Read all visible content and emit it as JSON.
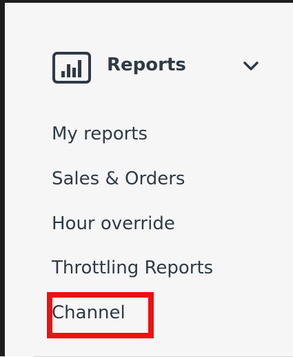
{
  "sidebar": {
    "section": {
      "label": "Reports",
      "icon": "bar-chart-icon",
      "toggle_icon": "chevron-down-icon",
      "expanded": true
    },
    "items": [
      {
        "label": "My reports"
      },
      {
        "label": "Sales & Orders"
      },
      {
        "label": "Hour override"
      },
      {
        "label": "Throttling Reports"
      },
      {
        "label": "Channel",
        "highlighted": true
      }
    ]
  },
  "colors": {
    "text": "#2f3a46",
    "highlight": "#ef1010",
    "background": "#f6f6f6",
    "frame": "#1d1d1d"
  }
}
